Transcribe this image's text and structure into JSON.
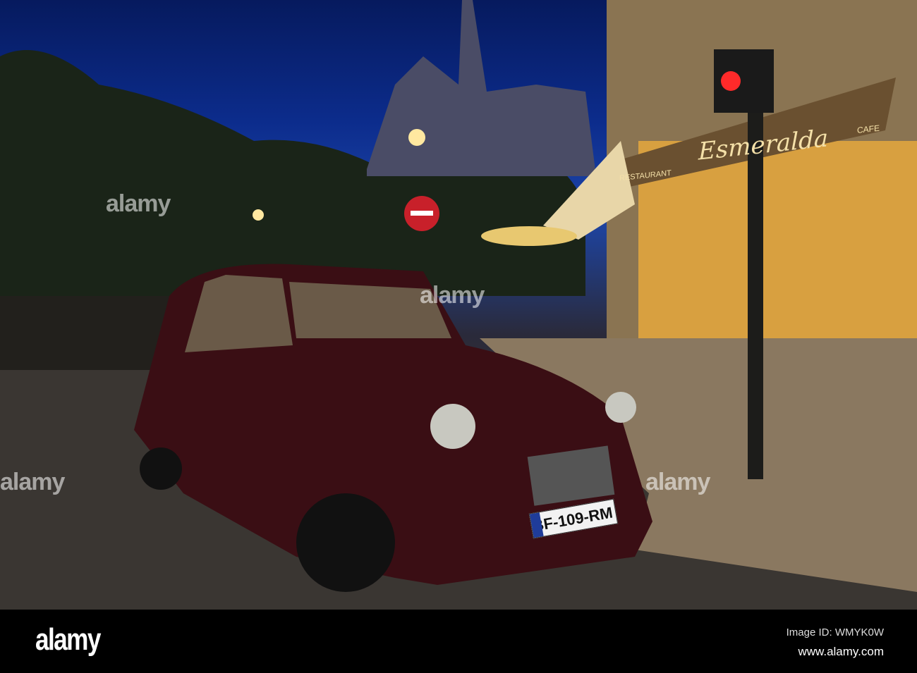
{
  "photo": {
    "subject": "Citroen 2CV parked near Esmeralda cafe with Notre-Dame at dusk",
    "sign_name": "Esmeralda",
    "sign_restaurant": "RESTAURANT",
    "sign_cafe": "CAFE",
    "license_plate": "BF-109-RM",
    "watermark": "alamy"
  },
  "footer": {
    "logo": "alamy",
    "image_id": "Image ID: WMYK0W",
    "url": "www.alamy.com"
  }
}
